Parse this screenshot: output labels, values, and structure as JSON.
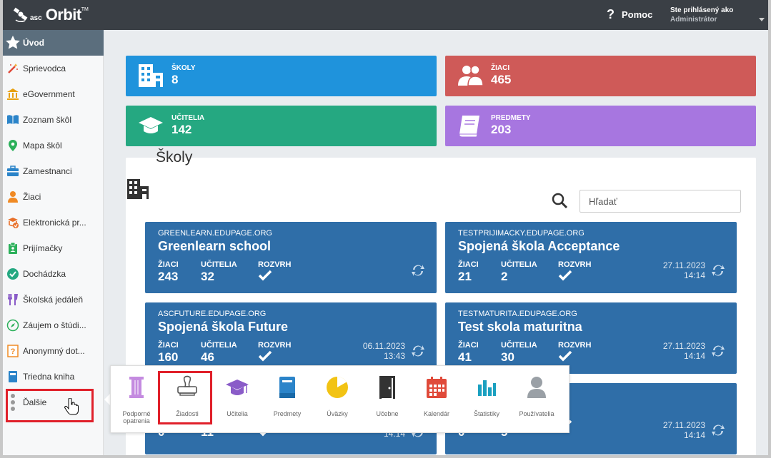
{
  "app": {
    "logo_asc": "asc",
    "logo_name": "Orbit",
    "logo_tm": "TM",
    "help_label": "Pomoc",
    "user_line1": "Ste prihlásený ako",
    "user_line2": "Administrátor"
  },
  "sidebar": {
    "items": [
      {
        "label": "Úvod",
        "icon": "star-icon"
      },
      {
        "label": "Sprievodca",
        "icon": "magic-wand-icon"
      },
      {
        "label": "eGovernment",
        "icon": "government-icon"
      },
      {
        "label": "Zoznam škôl",
        "icon": "book-open-icon"
      },
      {
        "label": "Mapa škôl",
        "icon": "map-pin-icon"
      },
      {
        "label": "Zamestnanci",
        "icon": "briefcase-icon"
      },
      {
        "label": "Žiaci",
        "icon": "student-icon"
      },
      {
        "label": "Elektronická pr...",
        "icon": "edocument-icon"
      },
      {
        "label": "Prijímačky",
        "icon": "clipboard-icon"
      },
      {
        "label": "Dochádzka",
        "icon": "check-circle-icon"
      },
      {
        "label": "Školská jedáleň",
        "icon": "cutlery-icon"
      },
      {
        "label": "Záujem o štúdi...",
        "icon": "compass-icon"
      },
      {
        "label": "Anonymný dot...",
        "icon": "question-doc-icon"
      },
      {
        "label": "Triedna kniha",
        "icon": "classbook-icon"
      },
      {
        "label": "Ďalšie",
        "icon": "more-dots-icon"
      }
    ]
  },
  "stats": [
    {
      "label": "ŠKOLY",
      "value": "8",
      "color": "#1f93dc"
    },
    {
      "label": "ŽIACI",
      "value": "465",
      "color": "#cf5a58"
    },
    {
      "label": "UČITELIA",
      "value": "142",
      "color": "#25a881"
    },
    {
      "label": "PREDMETY",
      "value": "203",
      "color": "#a776e0"
    }
  ],
  "schools": {
    "title": "Školy",
    "search_placeholder": "Hľadať",
    "cards": [
      {
        "domain": "GREENLEARN.EDUPAGE.ORG",
        "name": "Greenlearn school",
        "students_h": "ŽIACI",
        "students": "243",
        "teachers_h": "UČITELIA",
        "teachers": "32",
        "timetable_h": "ROZVRH",
        "date": "",
        "time": ""
      },
      {
        "domain": "TESTPRIJIMACKY.EDUPAGE.ORG",
        "name": "Spojená škola Acceptance",
        "students_h": "ŽIACI",
        "students": "21",
        "teachers_h": "UČITELIA",
        "teachers": "2",
        "timetable_h": "ROZVRH",
        "date": "27.11.2023",
        "time": "14:14"
      },
      {
        "domain": "ASCFUTURE.EDUPAGE.ORG",
        "name": "Spojená škola Future",
        "students_h": "ŽIACI",
        "students": "160",
        "teachers_h": "UČITELIA",
        "teachers": "46",
        "timetable_h": "ROZVRH",
        "date": "06.11.2023",
        "time": "13:43"
      },
      {
        "domain": "TESTMATURITA.EDUPAGE.ORG",
        "name": "Test skola maturitna",
        "students_h": "ŽIACI",
        "students": "41",
        "teachers_h": "UČITELIA",
        "teachers": "30",
        "timetable_h": "ROZVRH",
        "date": "27.11.2023",
        "time": "14:14"
      },
      {
        "domain": "",
        "name": "",
        "students_h": "",
        "students": "0",
        "teachers_h": "",
        "teachers": "11",
        "timetable_h": "",
        "date": "",
        "time": "14:14"
      },
      {
        "domain": "",
        "name": "",
        "students_h": "",
        "students": "0",
        "teachers_h": "",
        "teachers": "5",
        "timetable_h": "",
        "date": "27.11.2023",
        "time": "14:14"
      }
    ]
  },
  "popup": {
    "items": [
      {
        "label": "Podporné opatrenia",
        "icon": "pillar-icon",
        "color": "#c48be0"
      },
      {
        "label": "Žiadosti",
        "icon": "stamp-icon",
        "color": "#555555"
      },
      {
        "label": "Učitelia",
        "icon": "graduation-cap-icon",
        "color": "#8a5cc8"
      },
      {
        "label": "Predmety",
        "icon": "book-icon",
        "color": "#2b84c9"
      },
      {
        "label": "Úväzky",
        "icon": "pie-chart-icon",
        "color": "#f2c314"
      },
      {
        "label": "Učebne",
        "icon": "door-icon",
        "color": "#333333"
      },
      {
        "label": "Kalendár",
        "icon": "calendar-icon",
        "color": "#e04a3a"
      },
      {
        "label": "Štatistiky",
        "icon": "bar-chart-icon",
        "color": "#1aa0c0"
      },
      {
        "label": "Používatelia",
        "icon": "user-icon",
        "color": "#9aa0a6"
      }
    ]
  }
}
